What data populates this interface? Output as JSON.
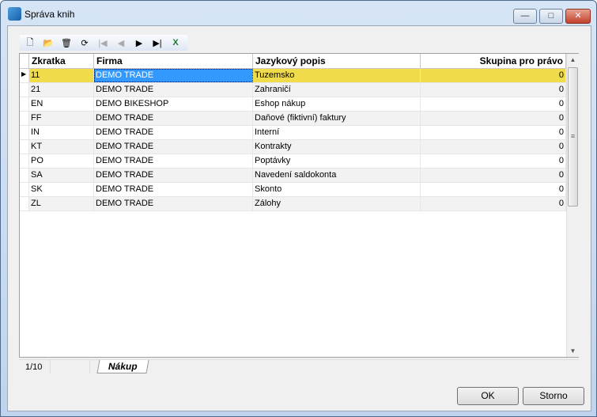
{
  "window": {
    "title": "Správa knih",
    "min": "—",
    "max": "□",
    "close": "✕"
  },
  "toolbar": [
    {
      "name": "new-icon",
      "glyph": "🗋",
      "enabled": true
    },
    {
      "name": "open-icon",
      "glyph": "📂",
      "enabled": true
    },
    {
      "name": "delete-icon",
      "glyph": "🗑",
      "enabled": true
    },
    {
      "name": "refresh-icon",
      "glyph": "⟳",
      "enabled": true
    },
    {
      "name": "first-record-icon",
      "glyph": "|◀",
      "enabled": false
    },
    {
      "name": "previous-record-icon",
      "glyph": "◀",
      "enabled": false
    },
    {
      "name": "next-record-icon",
      "glyph": "▶",
      "enabled": true
    },
    {
      "name": "last-record-icon",
      "glyph": "▶|",
      "enabled": true
    },
    {
      "name": "excel-export-icon",
      "glyph": "X",
      "enabled": true
    }
  ],
  "grid": {
    "columns": [
      "Zkratka",
      "Firma",
      "Jazykový popis",
      "Skupina pro právo"
    ],
    "rows": [
      [
        "11",
        "DEMO TRADE",
        "Tuzemsko",
        "0"
      ],
      [
        "21",
        "DEMO TRADE",
        "Zahraničí",
        "0"
      ],
      [
        "EN",
        "DEMO BIKESHOP",
        "Eshop nákup",
        "0"
      ],
      [
        "FF",
        "DEMO TRADE",
        "Daňové (fiktivní) faktury",
        "0"
      ],
      [
        "IN",
        "DEMO TRADE",
        "Interní",
        "0"
      ],
      [
        "KT",
        "DEMO TRADE",
        "Kontrakty",
        "0"
      ],
      [
        "PO",
        "DEMO TRADE",
        "Poptávky",
        "0"
      ],
      [
        "SA",
        "DEMO TRADE",
        "Navedení saldokonta",
        "0"
      ],
      [
        "SK",
        "DEMO TRADE",
        "Skonto",
        "0"
      ],
      [
        "ZL",
        "DEMO TRADE",
        "Zálohy",
        "0"
      ]
    ]
  },
  "status": {
    "position": "1/10",
    "tab": "Nákup"
  },
  "buttons": {
    "ok": "OK",
    "cancel": "Storno"
  },
  "colors": {
    "selected_row": "#f0dc4a",
    "selected_cell": "#3399ff"
  }
}
